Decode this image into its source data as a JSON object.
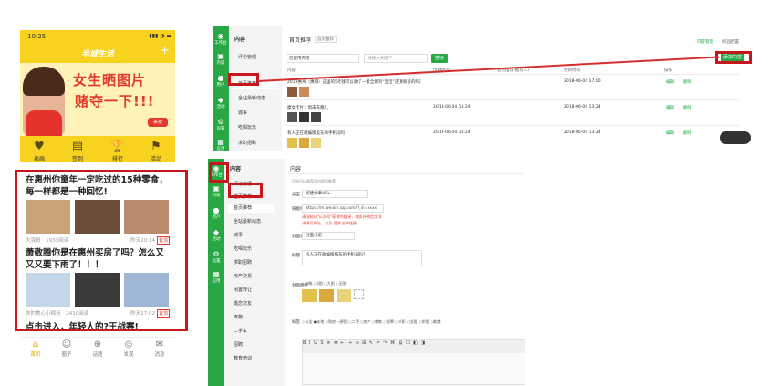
{
  "phone": {
    "status_time": "10:25",
    "status_right": "▮▮▮ ◔ ▬",
    "app_title": "半城生活",
    "plus": "+",
    "banner": {
      "line1": "女生晒图片",
      "line2": "赌夺一下!!!",
      "badge": "来抢"
    },
    "nav": [
      {
        "icon": "♥",
        "label": "表画"
      },
      {
        "icon": "▤",
        "label": "签到"
      },
      {
        "icon": "🏆",
        "label": "排行"
      },
      {
        "icon": "⚑",
        "label": "活动"
      }
    ],
    "posts": [
      {
        "title": "在惠州你童年一定吃过的15种零食，每一样都是一种回忆!",
        "author": "大强哥",
        "reads": "1933阅读",
        "date": "昨天20:14",
        "tag": "置顶"
      },
      {
        "title": "萧敬腾你是在惠州买房了吗？怎么又又又要下雨了！！！",
        "author": "你的美心小棉袄",
        "reads": "2410阅读",
        "date": "昨天17:02",
        "tag": "置顶"
      },
      {
        "title": "点击进入，年轻人的?王战赛!"
      }
    ],
    "tabs": [
      {
        "icon": "⌂",
        "label": "首页"
      },
      {
        "icon": "☺",
        "label": "圈子"
      },
      {
        "icon": "⊕",
        "label": "话题"
      },
      {
        "icon": "◎",
        "label": "发现"
      },
      {
        "icon": "✉",
        "label": "消息"
      }
    ],
    "colors": {
      "brand": "#f7d21f",
      "highlight": "#c8161d"
    }
  },
  "admin1": {
    "sidebar": [
      "工作台",
      "内容",
      "用户",
      "活动",
      "设置",
      "应用"
    ],
    "sub_title": "内容",
    "sub_items": [
      "评论管理",
      "首页推荐",
      "全站最新动态",
      "城事",
      "吃喝玩乐",
      "求职招聘"
    ],
    "section_title": "首页推荐",
    "tab_badge": "首页推荐",
    "top_links": [
      "内容管理",
      "校园配置"
    ],
    "select_value": "已使用内容",
    "search_placeholder": "请输入关键字",
    "search_btn": "搜索",
    "add_btn": "添加内容",
    "headers": [
      "内容",
      "创建时间",
      "首页推荐(推荐人)",
      "更新时间",
      "操作"
    ],
    "rows": [
      {
        "title": "2019惠州（惠阳）这里的5元钱可以收了一套全新的“宝宝”还要很多的吗？",
        "created": "",
        "updated": "2018-06-04 17:00",
        "actions": [
          "编辑",
          "删除"
        ]
      },
      {
        "title": "摩女卡片：周末去哪儿",
        "created": "2018-06-04 13:24",
        "updated": "2018-06-04 13:24",
        "actions": [
          "编辑",
          "删除"
        ]
      },
      {
        "title": "有人正在收编版股东的手机号吗",
        "created": "2018-06-04 13:24",
        "updated": "2018-06-04 13:24",
        "actions": [
          "编辑",
          "删除"
        ]
      }
    ]
  },
  "admin2": {
    "sidebar": [
      "工作台",
      "内容",
      "用户",
      "活动",
      "设置",
      "应用"
    ],
    "sub_title": "内容",
    "sub_items": [
      "评论管理",
      "首页推荐",
      "全站最新动态",
      "城事",
      "吃喝玩乐",
      "求职招聘",
      "房产交易",
      "闲置转让",
      "婚恋交友",
      "宠物",
      "二手车",
      "招聘",
      "教育培训"
    ],
    "section_title": "内容",
    "hint": "可选可以推荐至内容页推荐",
    "form": {
      "type_label": "类型",
      "type_value": "新建文章URL",
      "url_label": "链接地址",
      "url_value": "https://m.weixin.qq.com/?_d=xxxx",
      "red_hint1": "请复制从\"公众号\"获得的链接，仅支持微信文章",
      "red_hint2": "请填写网址，以及 是非法的链接",
      "cover_label": "封面标签",
      "cover_value": "封面小说",
      "title_label": "标题",
      "title_value": "有人正在收编版股东的手机号吗？",
      "img_label": "封面图片",
      "tag_label": "标签"
    },
    "sizes": [
      "缩略",
      "3图",
      "大图",
      "无图"
    ],
    "tags": [
      "公告",
      "本地",
      "购房",
      "便民",
      "二手",
      "房产",
      "教育",
      "招聘",
      "求职",
      "出租",
      "求租",
      "美食"
    ]
  }
}
